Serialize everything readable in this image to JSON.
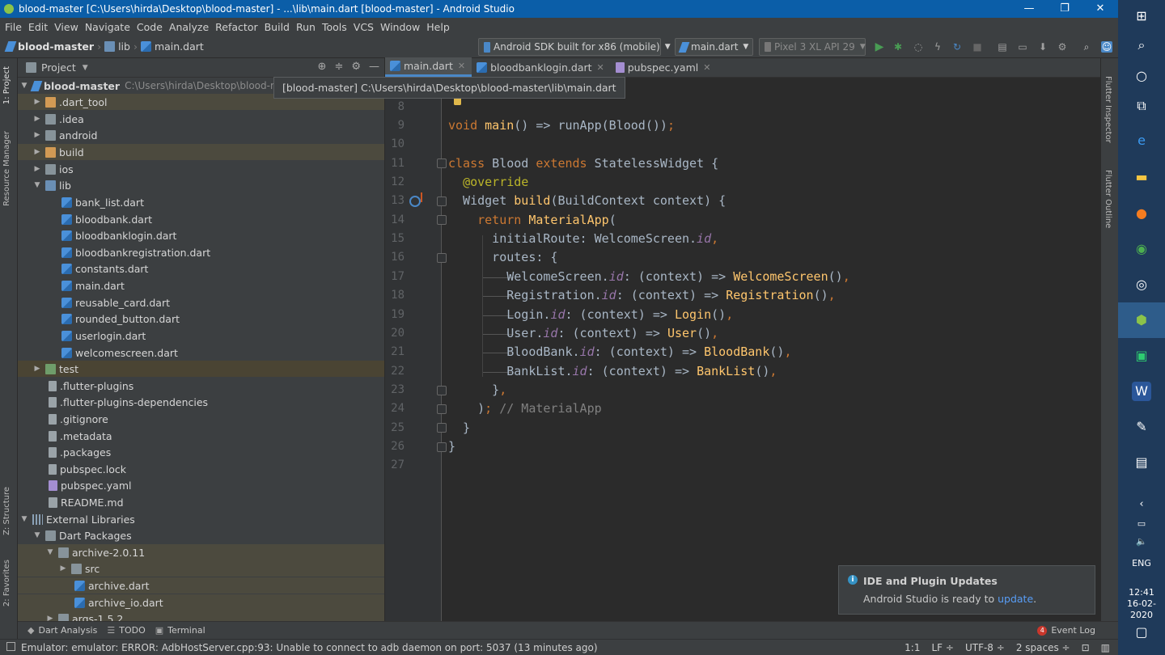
{
  "window": {
    "title": "blood-master [C:\\Users\\hirda\\Desktop\\blood-master] - ...\\lib\\main.dart [blood-master] - Android Studio",
    "minimize": "—",
    "maximize": "❐",
    "close": "✕"
  },
  "menu": [
    "File",
    "Edit",
    "View",
    "Navigate",
    "Code",
    "Analyze",
    "Refactor",
    "Build",
    "Run",
    "Tools",
    "VCS",
    "Window",
    "Help"
  ],
  "breadcrumb": {
    "project": "blood-master",
    "folder": "lib",
    "file": "main.dart"
  },
  "toolbar": {
    "device": "Android SDK built for x86 (mobile)",
    "run_config": "main.dart",
    "avd": "Pixel 3 XL API 29"
  },
  "project_panel": {
    "title": "Project",
    "tooltip": "[blood-master] C:\\Users\\hirda\\Desktop\\blood-master\\lib\\main.dart",
    "tree": [
      {
        "label": "blood-master",
        "path": "C:\\Users\\hirda\\Desktop\\blood-master",
        "icon": "module-icon",
        "twisty": "▼"
      },
      {
        "label": ".dart_tool",
        "icon": "folder-icon",
        "twisty": "▶"
      },
      {
        "label": ".idea",
        "icon": "folder-icon",
        "twisty": "▶"
      },
      {
        "label": "android",
        "icon": "folder-icon",
        "twisty": "▶"
      },
      {
        "label": "build",
        "icon": "folder-icon",
        "twisty": "▶"
      },
      {
        "label": "ios",
        "icon": "folder-icon",
        "twisty": "▶"
      },
      {
        "label": "lib",
        "icon": "folder-icon",
        "twisty": "▼"
      },
      {
        "label": "bank_list.dart",
        "icon": "dart-file-icon"
      },
      {
        "label": "bloodbank.dart",
        "icon": "dart-file-icon"
      },
      {
        "label": "bloodbanklogin.dart",
        "icon": "dart-file-icon"
      },
      {
        "label": "bloodbankregistration.dart",
        "icon": "dart-file-icon"
      },
      {
        "label": "constants.dart",
        "icon": "dart-file-icon"
      },
      {
        "label": "main.dart",
        "icon": "dart-file-icon"
      },
      {
        "label": "reusable_card.dart",
        "icon": "dart-file-icon"
      },
      {
        "label": "rounded_button.dart",
        "icon": "dart-file-icon"
      },
      {
        "label": "userlogin.dart",
        "icon": "dart-file-icon"
      },
      {
        "label": "welcomescreen.dart",
        "icon": "dart-file-icon"
      },
      {
        "label": "test",
        "icon": "folder-icon",
        "twisty": "▶"
      },
      {
        "label": ".flutter-plugins",
        "icon": "file-icon"
      },
      {
        "label": ".flutter-plugins-dependencies",
        "icon": "file-icon"
      },
      {
        "label": ".gitignore",
        "icon": "file-icon"
      },
      {
        "label": ".metadata",
        "icon": "file-icon"
      },
      {
        "label": ".packages",
        "icon": "file-icon"
      },
      {
        "label": "pubspec.lock",
        "icon": "file-icon"
      },
      {
        "label": "pubspec.yaml",
        "icon": "yaml-file-icon"
      },
      {
        "label": "README.md",
        "icon": "file-icon"
      },
      {
        "label": "External Libraries",
        "icon": "library-icon",
        "twisty": "▼"
      },
      {
        "label": "Dart Packages",
        "icon": "folder-icon",
        "twisty": "▼"
      },
      {
        "label": "archive-2.0.11",
        "icon": "folder-icon",
        "twisty": "▼"
      },
      {
        "label": "src",
        "icon": "folder-icon",
        "twisty": "▶"
      },
      {
        "label": "archive.dart",
        "icon": "dart-file-icon"
      },
      {
        "label": "archive_io.dart",
        "icon": "dart-file-icon"
      },
      {
        "label": "args-1.5.2",
        "icon": "folder-icon",
        "twisty": "▶"
      }
    ]
  },
  "tabs": [
    {
      "label": "main.dart"
    },
    {
      "label": "bloodbanklogin.dart"
    },
    {
      "label": "pubspec.yaml"
    }
  ],
  "editor": {
    "line_numbers": [
      "8",
      "9",
      "10",
      "11",
      "12",
      "13",
      "14",
      "15",
      "16",
      "17",
      "18",
      "19",
      "20",
      "21",
      "22",
      "23",
      "24",
      "25",
      "26",
      "27"
    ]
  },
  "side_tools": {
    "left": [
      "1: Project",
      "Resource Manager",
      "Z: Structure",
      "2: Favorites"
    ],
    "right": [
      "Flutter Inspector",
      "Flutter Outline"
    ]
  },
  "bottom_tools": {
    "dart_analysis": "Dart Analysis",
    "todo": "TODO",
    "terminal": "Terminal",
    "event_log": "Event Log",
    "event_count": "4"
  },
  "notification": {
    "title": "IDE and Plugin Updates",
    "body": "Android Studio is ready to ",
    "link": "update",
    "tail": "."
  },
  "status": {
    "message": "Emulator: emulator: ERROR: AdbHostServer.cpp:93: Unable to connect to adb daemon on port: 5037 (13 minutes ago)",
    "position": "1:1",
    "line_sep": "LF ÷",
    "encoding": "UTF-8 ÷",
    "indent": "2 spaces ÷"
  },
  "taskbar": {
    "lang": "ENG",
    "time": "12:41",
    "date": "16-02-2020"
  },
  "colors": {
    "titlebar": "#0b5ea8",
    "panel": "#3c3f41",
    "editor": "#2b2b2b",
    "keyword": "#cc7832",
    "function": "#ffc66d",
    "field": "#9876aa"
  }
}
